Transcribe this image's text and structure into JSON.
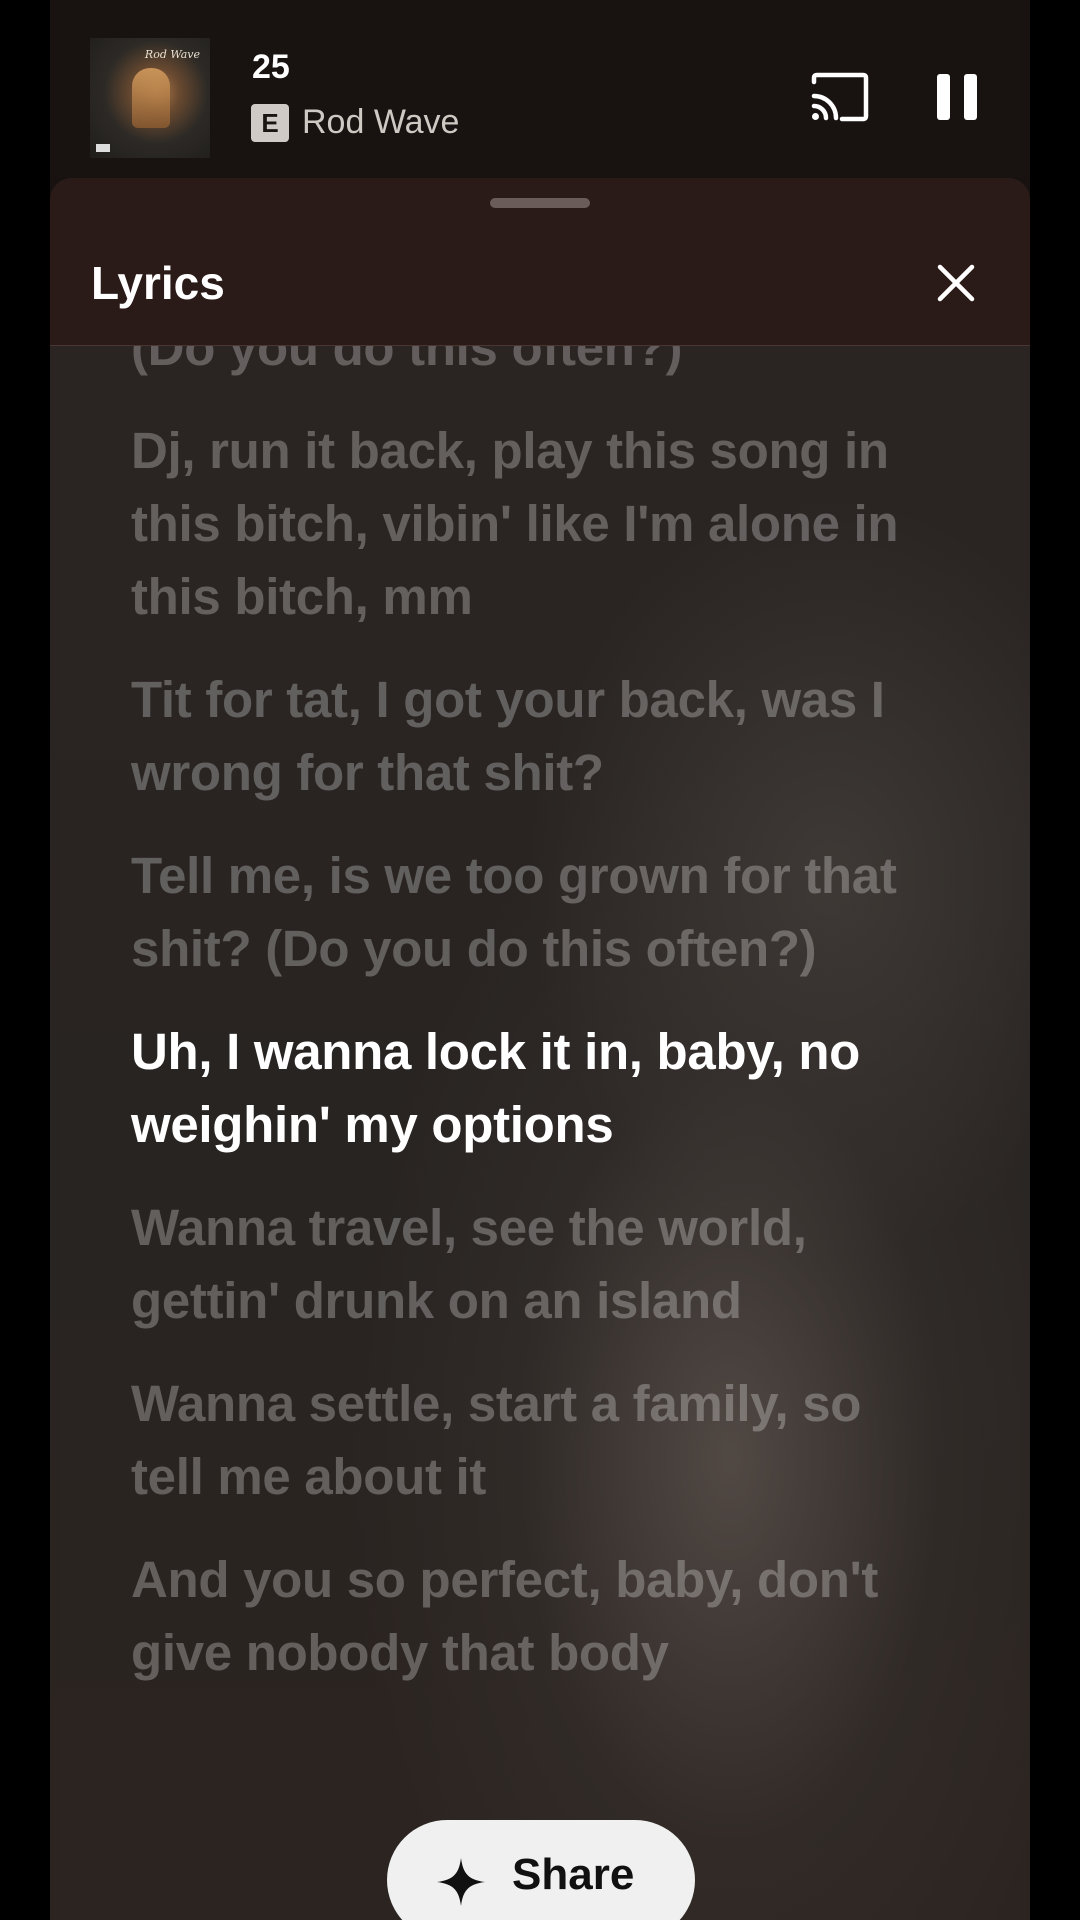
{
  "mini_player": {
    "track_title": "25",
    "explicit_badge": "E",
    "artist": "Rod Wave",
    "album_art_signature": "Rod Wave",
    "icons": {
      "cast": "cast-icon",
      "pause": "pause-icon"
    }
  },
  "lyrics_sheet": {
    "title": "Lyrics",
    "close_icon": "close-icon",
    "lines": [
      {
        "text": "(Do you do this often?)",
        "active": false
      },
      {
        "text": "Dj, run it back, play this song in this bitch, vibin' like I'm alone in this bitch, mm",
        "active": false
      },
      {
        "text": "Tit for tat, I got your back, was I wrong for that shit?",
        "active": false
      },
      {
        "text": "Tell me, is we too grown for that shit? (Do you do this often?)",
        "active": false
      },
      {
        "text": "Uh, I wanna lock it in, baby, no weighin' my options",
        "active": true
      },
      {
        "text": "Wanna travel, see the world, gettin' drunk on an island",
        "active": false
      },
      {
        "text": "Wanna settle, start a family, so tell me about it",
        "active": false
      },
      {
        "text": "And you so perfect, baby, don't give nobody that body",
        "active": false
      }
    ]
  },
  "share_button": {
    "label": "Share",
    "icon": "sparkle-icon"
  }
}
